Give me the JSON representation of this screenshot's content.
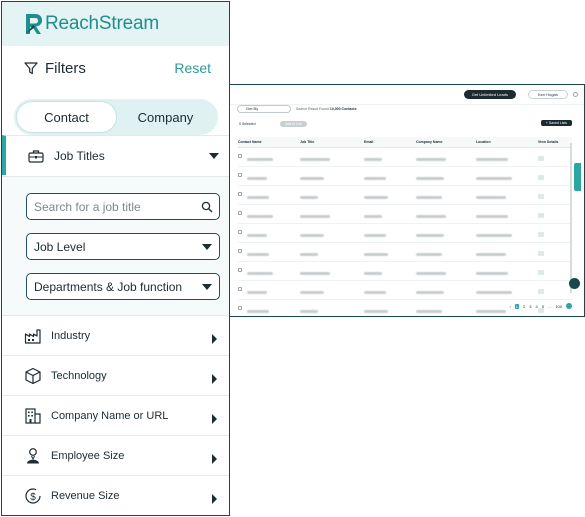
{
  "panel": {
    "logo": {
      "text": "ReachStream",
      "color": "#1e8f8c"
    },
    "filters_title": "Filters",
    "reset_label": "Reset",
    "segment": {
      "options": [
        "Contact",
        "Company"
      ],
      "selected": "Contact"
    },
    "job_titles": {
      "label": "Job Titles",
      "search_placeholder": "Search for a job title",
      "job_level": "Job Level",
      "departments": "Departments & Job function"
    },
    "rows": [
      {
        "label": "Industry",
        "icon": "factory-icon"
      },
      {
        "label": "Technology",
        "icon": "cube-icon"
      },
      {
        "label": "Company Name or URL",
        "icon": "building-icon"
      },
      {
        "label": "Employee Size",
        "icon": "person-icon"
      },
      {
        "label": "Revenue Size",
        "icon": "dollar-icon"
      }
    ],
    "accent": "#2aa6a3"
  },
  "preview": {
    "unlimited_button": "Get Unlimited Leads",
    "user_button": "Ken Hogan",
    "search_text": "Get By",
    "found_prefix": "Search Result Found",
    "found_count": "10,000 Contacts",
    "selected_text": "0 Selected",
    "add_list": "Add to List",
    "save_list": "+ Saved Lists",
    "columns": [
      "Contact Name",
      "Job Title",
      "Email",
      "Company Name",
      "Location",
      "View Details"
    ],
    "pager": [
      "1",
      "2",
      "3",
      "4",
      "5",
      "...",
      "100"
    ]
  }
}
